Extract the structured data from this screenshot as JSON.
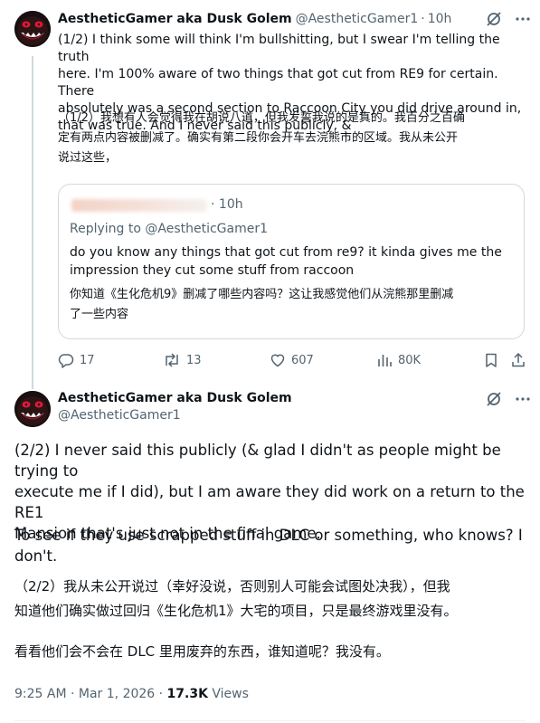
{
  "colors": {
    "text": "#0f1419",
    "muted": "#536471",
    "border": "#cfd9de",
    "accent": "#1d9bf0"
  },
  "tweet1": {
    "author_name": "AestheticGamer aka Dusk Golem",
    "handle": "@AestheticGamer1",
    "separator": "·",
    "time": "10h",
    "text_lines": [
      "(1/2) I think some will think I'm bullshitting, but I swear I'm telling the truth",
      "here. I'm 100% aware of two things that got cut from RE9 for certain. There",
      "absolutely was a second section to Raccoon City you did drive around in,",
      "that was true. And I never said this publicly, &"
    ],
    "translation_lines": [
      "（1/2）我想有人会觉得我在胡说八道，但我发誓我说的是真的。我百分之百确",
      "定有两点内容被删减了。确实有第二段你会开车去浣熊市的区域。我从未公开",
      "说过这些，"
    ],
    "quoted": {
      "time": "10h",
      "replying_to": "Replying to @AestheticGamer1",
      "text_lines": [
        "do you know any things that got cut from re9? it kinda gives me the",
        "impression they cut some stuff from raccoon"
      ],
      "translation_lines": [
        "你知道《生化危机9》删减了哪些内容吗？这让我感觉他们从浣熊那里删减",
        "了一些内容"
      ]
    },
    "actions": {
      "replies": "17",
      "reposts": "13",
      "likes": "607",
      "views": "80K"
    },
    "icons": [
      "grok-icon",
      "more-icon",
      "reply-icon",
      "repost-icon",
      "like-icon",
      "views-icon",
      "bookmark-icon",
      "share-icon"
    ]
  },
  "tweet2": {
    "author_name": "AestheticGamer aka Dusk Golem",
    "handle": "@AestheticGamer1",
    "text_lines": [
      "(2/2) I never said this publicly (& glad I didn't as people might be trying to",
      "execute me if I did), but I am aware they did work on a return to the RE1",
      "Mansion that's just not in the final game."
    ],
    "text_lines_2": [
      "To see if they use scrapped stuff in DLC or something, who knows? I",
      "don't."
    ],
    "translation_lines": [
      "（2/2）我从未公开说过（幸好没说，否则别人可能会试图处决我），但我",
      "知道他们确实做过回归《生化危机1》大宅的项目，只是最终游戏里没有。"
    ],
    "translation_lines_2": [
      "看看他们会不会在 DLC 里用废弃的东西，谁知道呢？我没有。"
    ],
    "timestamp": "9:25 AM · Mar 1, 2026 · ",
    "views_count": "17.3K",
    "views_label": " Views"
  }
}
